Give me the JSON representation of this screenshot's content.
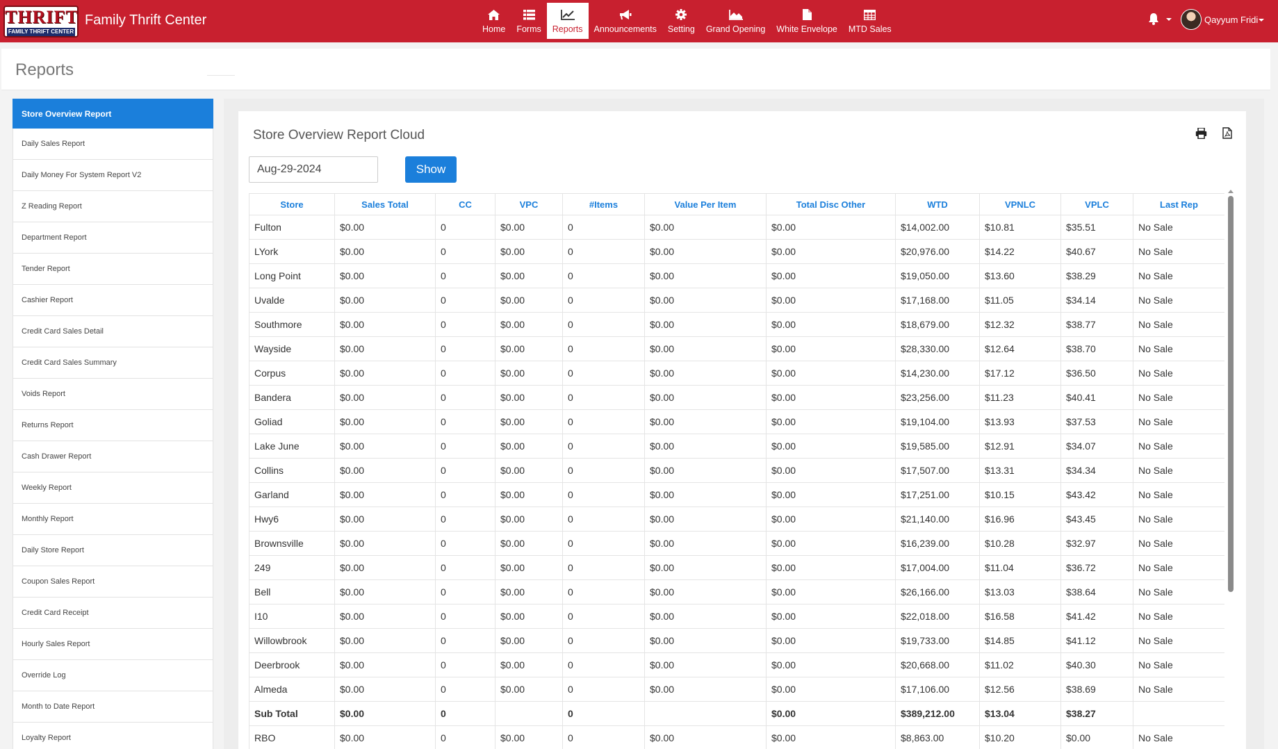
{
  "header": {
    "logo_top": "THRIFT",
    "logo_bottom": "FAMILY THRIFT CENTER",
    "app_title": "Family Thrift Center",
    "user_name": "Qayyum Fridi"
  },
  "nav": [
    {
      "label": "Home",
      "icon": "home-icon"
    },
    {
      "label": "Forms",
      "icon": "list-icon"
    },
    {
      "label": "Reports",
      "icon": "line-chart-icon",
      "active": true
    },
    {
      "label": "Announcements",
      "icon": "bullhorn-icon"
    },
    {
      "label": "Setting",
      "icon": "gear-icon"
    },
    {
      "label": "Grand Opening",
      "icon": "area-chart-icon"
    },
    {
      "label": "White Envelope",
      "icon": "file-icon"
    },
    {
      "label": "MTD Sales",
      "icon": "table-icon"
    }
  ],
  "page": {
    "title": "Reports"
  },
  "sidebar": {
    "items": [
      "Store Overview Report",
      "Daily Sales Report",
      "Daily Money For System Report V2",
      "Z Reading Report",
      "Department Report",
      "Tender Report",
      "Cashier Report",
      "Credit Card Sales Detail",
      "Credit Card Sales Summary",
      "Voids Report",
      "Returns Report",
      "Cash Drawer Report",
      "Weekly Report",
      "Monthly Report",
      "Daily Store Report",
      "Coupon Sales Report",
      "Credit Card Receipt",
      "Hourly Sales Report",
      "Override Log",
      "Month to Date Report",
      "Loyalty Report"
    ],
    "active_index": 0
  },
  "report": {
    "title": "Store Overview Report Cloud",
    "date_value": "Aug-29-2024",
    "show_label": "Show",
    "columns": [
      "Store",
      "Sales Total",
      "CC",
      "VPC",
      "#Items",
      "Value Per Item",
      "Total Disc Other",
      "WTD",
      "VPNLC",
      "VPLC",
      "Last Rep"
    ],
    "rows": [
      [
        "Fulton",
        "$0.00",
        "0",
        "$0.00",
        "0",
        "$0.00",
        "$0.00",
        "$14,002.00",
        "$10.81",
        "$35.51",
        "No Sale"
      ],
      [
        "LYork",
        "$0.00",
        "0",
        "$0.00",
        "0",
        "$0.00",
        "$0.00",
        "$20,976.00",
        "$14.22",
        "$40.67",
        "No Sale"
      ],
      [
        "Long Point",
        "$0.00",
        "0",
        "$0.00",
        "0",
        "$0.00",
        "$0.00",
        "$19,050.00",
        "$13.60",
        "$38.29",
        "No Sale"
      ],
      [
        "Uvalde",
        "$0.00",
        "0",
        "$0.00",
        "0",
        "$0.00",
        "$0.00",
        "$17,168.00",
        "$11.05",
        "$34.14",
        "No Sale"
      ],
      [
        "Southmore",
        "$0.00",
        "0",
        "$0.00",
        "0",
        "$0.00",
        "$0.00",
        "$18,679.00",
        "$12.32",
        "$38.77",
        "No Sale"
      ],
      [
        "Wayside",
        "$0.00",
        "0",
        "$0.00",
        "0",
        "$0.00",
        "$0.00",
        "$28,330.00",
        "$12.64",
        "$38.70",
        "No Sale"
      ],
      [
        "Corpus",
        "$0.00",
        "0",
        "$0.00",
        "0",
        "$0.00",
        "$0.00",
        "$14,230.00",
        "$17.12",
        "$36.50",
        "No Sale"
      ],
      [
        "Bandera",
        "$0.00",
        "0",
        "$0.00",
        "0",
        "$0.00",
        "$0.00",
        "$23,256.00",
        "$11.23",
        "$40.41",
        "No Sale"
      ],
      [
        "Goliad",
        "$0.00",
        "0",
        "$0.00",
        "0",
        "$0.00",
        "$0.00",
        "$19,104.00",
        "$13.93",
        "$37.53",
        "No Sale"
      ],
      [
        "Lake June",
        "$0.00",
        "0",
        "$0.00",
        "0",
        "$0.00",
        "$0.00",
        "$19,585.00",
        "$12.91",
        "$34.07",
        "No Sale"
      ],
      [
        "Collins",
        "$0.00",
        "0",
        "$0.00",
        "0",
        "$0.00",
        "$0.00",
        "$17,507.00",
        "$13.31",
        "$34.34",
        "No Sale"
      ],
      [
        "Garland",
        "$0.00",
        "0",
        "$0.00",
        "0",
        "$0.00",
        "$0.00",
        "$17,251.00",
        "$10.15",
        "$43.42",
        "No Sale"
      ],
      [
        "Hwy6",
        "$0.00",
        "0",
        "$0.00",
        "0",
        "$0.00",
        "$0.00",
        "$21,140.00",
        "$16.96",
        "$43.45",
        "No Sale"
      ],
      [
        "Brownsville",
        "$0.00",
        "0",
        "$0.00",
        "0",
        "$0.00",
        "$0.00",
        "$16,239.00",
        "$10.28",
        "$32.97",
        "No Sale"
      ],
      [
        "249",
        "$0.00",
        "0",
        "$0.00",
        "0",
        "$0.00",
        "$0.00",
        "$17,004.00",
        "$11.04",
        "$36.72",
        "No Sale"
      ],
      [
        "Bell",
        "$0.00",
        "0",
        "$0.00",
        "0",
        "$0.00",
        "$0.00",
        "$26,166.00",
        "$13.03",
        "$38.64",
        "No Sale"
      ],
      [
        "I10",
        "$0.00",
        "0",
        "$0.00",
        "0",
        "$0.00",
        "$0.00",
        "$22,018.00",
        "$16.58",
        "$41.42",
        "No Sale"
      ],
      [
        "Willowbrook",
        "$0.00",
        "0",
        "$0.00",
        "0",
        "$0.00",
        "$0.00",
        "$19,733.00",
        "$14.85",
        "$41.12",
        "No Sale"
      ],
      [
        "Deerbrook",
        "$0.00",
        "0",
        "$0.00",
        "0",
        "$0.00",
        "$0.00",
        "$20,668.00",
        "$11.02",
        "$40.30",
        "No Sale"
      ],
      [
        "Almeda",
        "$0.00",
        "0",
        "$0.00",
        "0",
        "$0.00",
        "$0.00",
        "$17,106.00",
        "$12.56",
        "$38.69",
        "No Sale"
      ]
    ],
    "subtotal": [
      "Sub Total",
      "$0.00",
      "0",
      "",
      "0",
      "",
      "$0.00",
      "$389,212.00",
      "$13.04",
      "$38.27",
      ""
    ],
    "extra_rows": [
      [
        "RBO",
        "$0.00",
        "0",
        "$0.00",
        "0",
        "$0.00",
        "$0.00",
        "$8,863.00",
        "$10.20",
        "$0.00",
        "No Sale"
      ]
    ]
  },
  "colors": {
    "brand_red": "#c8202f",
    "accent_blue": "#1b7fdb"
  }
}
